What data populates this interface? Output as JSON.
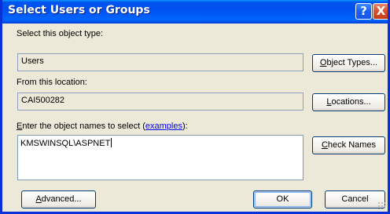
{
  "window": {
    "title": "Select Users or Groups",
    "help_glyph": "?",
    "close_glyph": "X"
  },
  "object_type": {
    "label": "Select this object type:",
    "value": "Users",
    "button_label": "Object Types..."
  },
  "location": {
    "label": "From this location:",
    "value": "CAI500282",
    "button_label": "Locations..."
  },
  "names": {
    "label_prefix_underlined": "E",
    "label_rest": "nter the object names to select (",
    "link_text": "examples",
    "label_suffix": "):",
    "value": "KMSWINSQL\\ASPNET",
    "check_names_label": "Check Names"
  },
  "footer": {
    "advanced_label": "Advanced...",
    "ok_label": "OK",
    "cancel_label": "Cancel"
  },
  "colors": {
    "titlebar": "#0054e3",
    "dialog_bg": "#ece9d8",
    "link": "#0000ff"
  }
}
